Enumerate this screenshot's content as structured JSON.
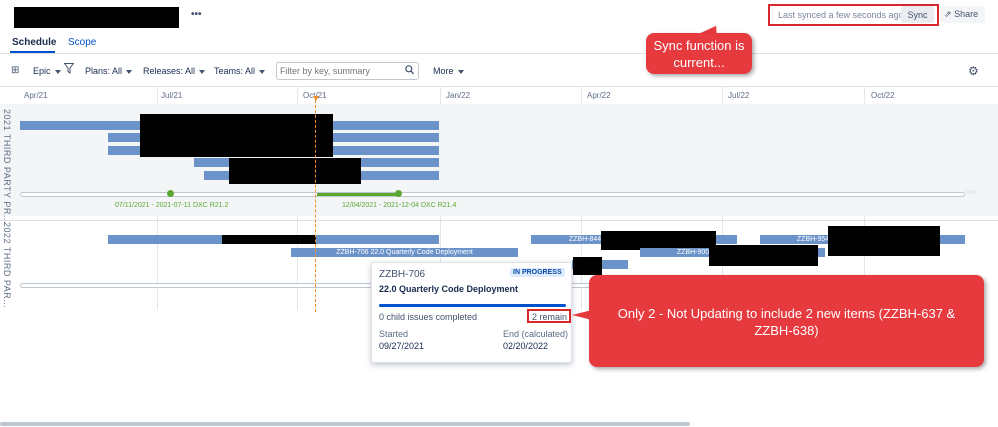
{
  "header": {
    "more_glyph": "•••",
    "sync_status": "Last synced a few seconds ago",
    "sync_label": "Sync",
    "share_label": "Share"
  },
  "tabs": [
    {
      "label": "Schedule",
      "active": true
    },
    {
      "label": "Scope",
      "active": false
    }
  ],
  "toolbar": {
    "hierarchy_label": "Epic",
    "plans_label": "Plans: All",
    "releases_label": "Releases: All",
    "teams_label": "Teams: All",
    "filter_placeholder": "Filter by key, summary",
    "more_label": "More"
  },
  "timeline": {
    "ticks": [
      "Apr/21",
      "Jul/21",
      "Oct/21",
      "Jan/22",
      "Apr/22",
      "Jul/22",
      "Oct/22"
    ]
  },
  "swimlanes": [
    {
      "label": "2021 THIRD PARTY PR..."
    },
    {
      "label": "2022 THIRD PAR..."
    }
  ],
  "releases": [
    {
      "label": "07/11/2021 - 2021-07-11 DXC R21.2"
    },
    {
      "label": "12/04/2021 - 2021-12-04 DXC R21.4"
    }
  ],
  "bars_2022": {
    "b706": "ZZBH-706 22.0 Quarterly Code Deployment",
    "b844": "ZZBH-844",
    "b900": "ZZBH-900",
    "b954": "ZZBH-954"
  },
  "popover": {
    "key": "ZZBH-706",
    "status": "IN PROGRESS",
    "title": "22.0 Quarterly Code Deployment",
    "progress": 1.0,
    "child_issues": "0 child issues completed",
    "remain": "2 remain",
    "started_label": "Started",
    "started_value": "09/27/2021",
    "end_label": "End (calculated)",
    "end_value": "02/20/2022"
  },
  "annotations": {
    "sync_note": "Sync function is current...",
    "update_note": "Only 2 - Not Updating to include 2 new items (ZZBH-637 & ZZBH-638)"
  },
  "colors": {
    "bar": "#6b93c9",
    "accent": "#0052cc",
    "release": "#5aa832",
    "today": "#f18e2c",
    "callout": "#e63a3f"
  }
}
